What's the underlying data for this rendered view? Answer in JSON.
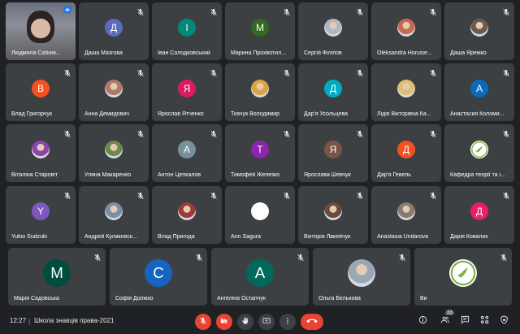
{
  "participants": [
    {
      "name": "Людмила Сабоні...",
      "initial": "",
      "color": "",
      "type": "self"
    },
    {
      "name": "Даша Мазгова",
      "initial": "Д",
      "color": "#5c6bc0",
      "type": "letter"
    },
    {
      "name": "Іван Солодковський",
      "initial": "І",
      "color": "#00897b",
      "type": "letter"
    },
    {
      "name": "Марина Прохвотил...",
      "initial": "М",
      "color": "#33691e",
      "type": "letter"
    },
    {
      "name": "Сергій Філіпов",
      "initial": "",
      "color": "#b0b7c3",
      "type": "photo"
    },
    {
      "name": "Oleksandra Horusie...",
      "initial": "",
      "color": "#c76b4e",
      "type": "photo"
    },
    {
      "name": "Даша Яремко",
      "initial": "",
      "color": "#6f5a4a",
      "type": "photo"
    },
    {
      "name": "Влад Григорчук",
      "initial": "В",
      "color": "#f4511e",
      "type": "letter"
    },
    {
      "name": "Анна Демидович",
      "initial": "",
      "color": "#b07a6a",
      "type": "photo"
    },
    {
      "name": "Ярослав Ятченко",
      "initial": "Я",
      "color": "#d81b60",
      "type": "letter"
    },
    {
      "name": "Ткачук Володимир",
      "initial": "",
      "color": "#d9a441",
      "type": "photo"
    },
    {
      "name": "Дар'я Усольцева",
      "initial": "Д",
      "color": "#00acc1",
      "type": "letter"
    },
    {
      "name": "Лідія Вікторівна Ка...",
      "initial": "",
      "color": "#e0c070",
      "type": "photo"
    },
    {
      "name": "Анастасия Коломи...",
      "initial": "А",
      "color": "#0b6bb8",
      "type": "letter"
    },
    {
      "name": "Віталіна Старовіт",
      "initial": "",
      "color": "#8e44ad",
      "type": "photo"
    },
    {
      "name": "Уляна Макаренко",
      "initial": "",
      "color": "#6a8a4a",
      "type": "photo"
    },
    {
      "name": "Антон Цепкалов",
      "initial": "А",
      "color": "#78909c",
      "type": "letter"
    },
    {
      "name": "Тимофей Железко",
      "initial": "Т",
      "color": "#8e24aa",
      "type": "letter"
    },
    {
      "name": "Ярослава Шевчук",
      "initial": "Я",
      "color": "#795548",
      "type": "letter"
    },
    {
      "name": "Дар'я Гевель",
      "initial": "Д",
      "color": "#f4511e",
      "type": "letter"
    },
    {
      "name": "Кафедра теорії та і...",
      "initial": "",
      "color": "#ffffff",
      "type": "logo"
    },
    {
      "name": "Yukio Sudzuki",
      "initial": "Y",
      "color": "#7e57c2",
      "type": "letter"
    },
    {
      "name": "Андрей Кулаковск...",
      "initial": "",
      "color": "#7a8ea5",
      "type": "photo"
    },
    {
      "name": "Влад Пригода",
      "initial": "",
      "color": "#9a3a3a",
      "type": "photo"
    },
    {
      "name": "Ann Sagura",
      "initial": "",
      "color": "#ffffff",
      "type": "blank"
    },
    {
      "name": "Вікторія Лакейчук",
      "initial": "",
      "color": "#6b4a3a",
      "type": "photo"
    },
    {
      "name": "Anastasia Undarova",
      "initial": "",
      "color": "#8a7a6a",
      "type": "photo"
    },
    {
      "name": "Дарія Ковалик",
      "initial": "Д",
      "color": "#e91e63",
      "type": "letter"
    },
    {
      "name": "Марія Садовська",
      "initial": "М",
      "color": "#004d40",
      "type": "letter"
    },
    {
      "name": "Софія Должко",
      "initial": "С",
      "color": "#1565c0",
      "type": "letter"
    },
    {
      "name": "Ангеліна Остапчук",
      "initial": "А",
      "color": "#00695c",
      "type": "letter"
    },
    {
      "name": "Ольга Белькова",
      "initial": "",
      "color": "#9aa8b5",
      "type": "photo"
    },
    {
      "name": "Ви",
      "initial": "",
      "color": "#ffffff",
      "type": "logo"
    }
  ],
  "bottom_bar": {
    "time": "12:27",
    "separator": "|",
    "meeting_title": "Школа знавців права-2021",
    "participant_count": "33"
  },
  "icons": {
    "mic_off": "mic-off-icon",
    "cam_off": "videocam-off-icon",
    "hand": "raise-hand-icon",
    "present": "present-screen-icon",
    "more": "more-vert-icon",
    "end_call": "end-call-icon",
    "info": "info-icon",
    "people": "people-icon",
    "chat": "chat-icon",
    "activities": "activities-icon"
  },
  "colors": {
    "accent": "#8ab4f8",
    "danger": "#ea4335",
    "tile": "#3c4043"
  }
}
